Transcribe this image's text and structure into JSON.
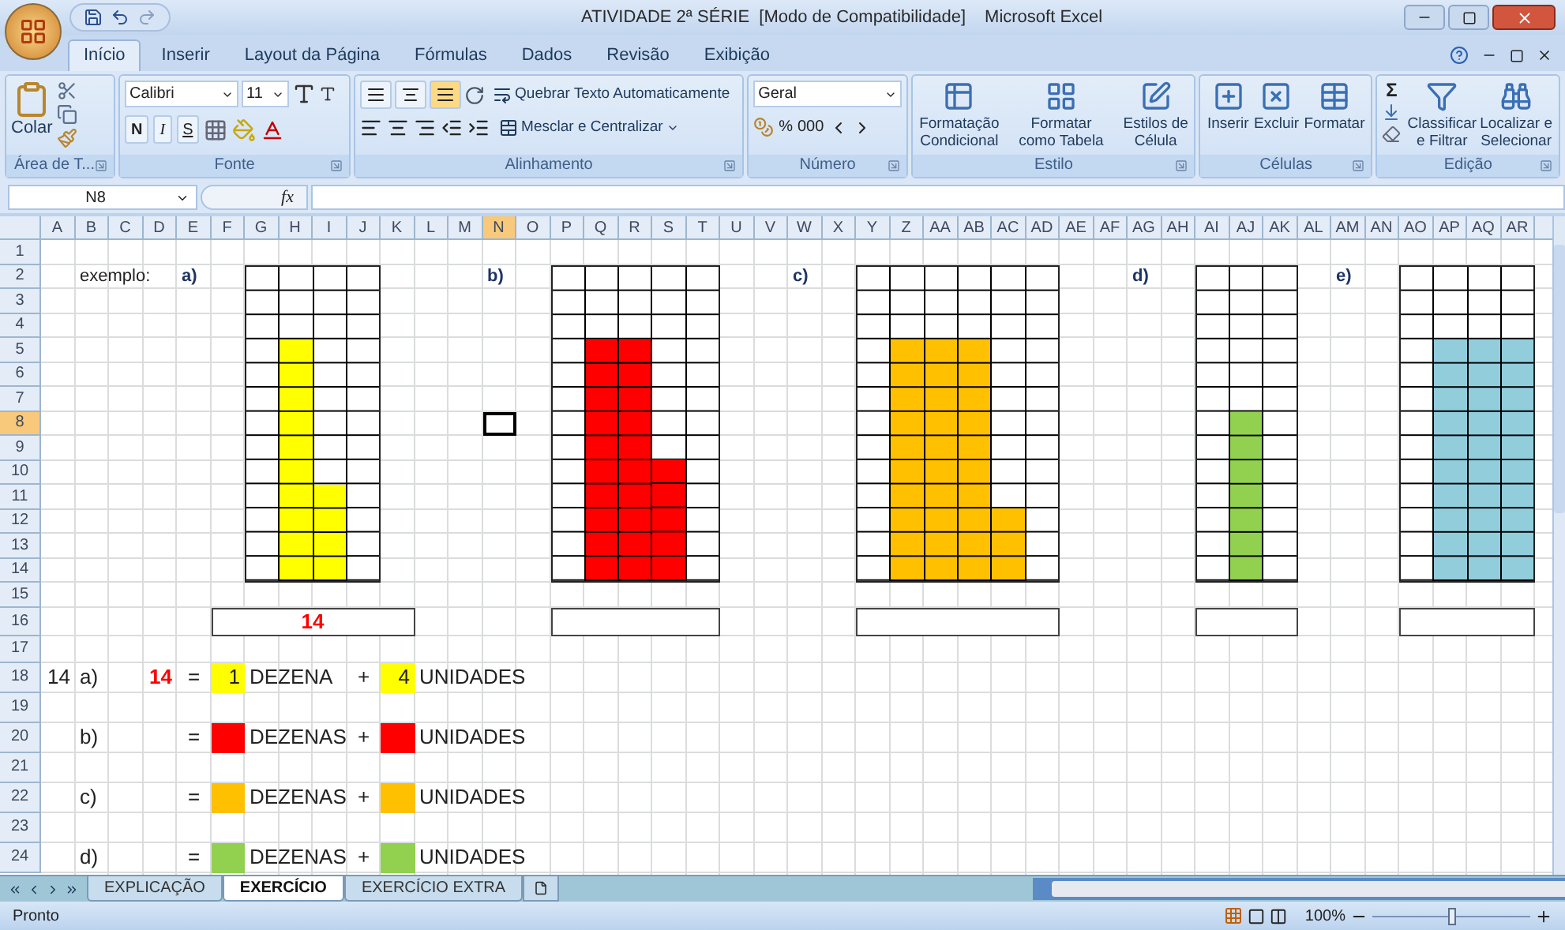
{
  "title_bar": {
    "document": "ATIVIDADE 2ª SÉRIE  [Modo de Compatibilidade]",
    "app": "Microsoft Excel"
  },
  "ribbon_tabs": [
    {
      "label": "Início",
      "selected": true
    },
    {
      "label": "Inserir",
      "selected": false
    },
    {
      "label": "Layout da Página",
      "selected": false
    },
    {
      "label": "Fórmulas",
      "selected": false
    },
    {
      "label": "Dados",
      "selected": false
    },
    {
      "label": "Revisão",
      "selected": false
    },
    {
      "label": "Exibição",
      "selected": false
    }
  ],
  "ribbon_groups": [
    {
      "kind": "clipboard",
      "label": "Área de T...",
      "paste": "Colar"
    },
    {
      "kind": "font",
      "label": "Fonte",
      "font": "Calibri",
      "size": "11",
      "bold": "N",
      "italic": "I",
      "underline": "S"
    },
    {
      "kind": "alignment",
      "label": "Alinhamento",
      "wrap": "Quebrar Texto Automaticamente",
      "merge": "Mesclar e Centralizar",
      "vertical_align": [
        {
          "selected": false
        },
        {
          "selected": false
        },
        {
          "selected": true
        }
      ]
    },
    {
      "kind": "number",
      "label": "Número",
      "format": "Geral",
      "percent": "%",
      "thousands": "000"
    },
    {
      "kind": "styles",
      "label": "Estilo",
      "buttons": [
        {
          "lines": [
            "Formatação",
            "Condicional"
          ]
        },
        {
          "lines": [
            "Formatar",
            "como Tabela"
          ]
        },
        {
          "lines": [
            "Estilos de",
            "Célula"
          ]
        }
      ]
    },
    {
      "kind": "cells",
      "label": "Células",
      "buttons": [
        {
          "lines": [
            "Inserir"
          ]
        },
        {
          "lines": [
            "Excluir"
          ]
        },
        {
          "lines": [
            "Formatar"
          ]
        }
      ]
    },
    {
      "kind": "editing",
      "label": "Edição",
      "sum": "Σ",
      "buttons": [
        {
          "lines": [
            "Classificar",
            "e Filtrar"
          ]
        },
        {
          "lines": [
            "Localizar e",
            "Selecionar"
          ]
        }
      ]
    }
  ],
  "formula_bar": {
    "name_box": "N8",
    "function_label": "fx"
  },
  "sheet": {
    "columns": [
      {
        "label": "A",
        "selected": false
      },
      {
        "label": "B",
        "selected": false
      },
      {
        "label": "C",
        "selected": false
      },
      {
        "label": "D",
        "selected": false
      },
      {
        "label": "E",
        "selected": false
      },
      {
        "label": "F",
        "selected": false
      },
      {
        "label": "G",
        "selected": false
      },
      {
        "label": "H",
        "selected": false
      },
      {
        "label": "I",
        "selected": false
      },
      {
        "label": "J",
        "selected": false
      },
      {
        "label": "K",
        "selected": false
      },
      {
        "label": "L",
        "selected": false
      },
      {
        "label": "M",
        "selected": false
      },
      {
        "label": "N",
        "selected": true
      },
      {
        "label": "O",
        "selected": false
      },
      {
        "label": "P",
        "selected": false
      },
      {
        "label": "Q",
        "selected": false
      },
      {
        "label": "R",
        "selected": false
      },
      {
        "label": "S",
        "selected": false
      },
      {
        "label": "T",
        "selected": false
      },
      {
        "label": "U",
        "selected": false
      },
      {
        "label": "V",
        "selected": false
      },
      {
        "label": "W",
        "selected": false
      },
      {
        "label": "X",
        "selected": false
      },
      {
        "label": "Y",
        "selected": false
      },
      {
        "label": "Z",
        "selected": false
      },
      {
        "label": "AA",
        "selected": false
      },
      {
        "label": "AB",
        "selected": false
      },
      {
        "label": "AC",
        "selected": false
      },
      {
        "label": "AD",
        "selected": false
      },
      {
        "label": "AE",
        "selected": false
      },
      {
        "label": "AF",
        "selected": false
      },
      {
        "label": "AG",
        "selected": false
      },
      {
        "label": "AH",
        "selected": false
      },
      {
        "label": "AI",
        "selected": false
      },
      {
        "label": "AJ",
        "selected": false
      },
      {
        "label": "AK",
        "selected": false
      },
      {
        "label": "AL",
        "selected": false
      },
      {
        "label": "AM",
        "selected": false
      },
      {
        "label": "AN",
        "selected": false
      },
      {
        "label": "AO",
        "selected": false
      },
      {
        "label": "AP",
        "selected": false
      },
      {
        "label": "AQ",
        "selected": false
      },
      {
        "label": "AR",
        "selected": false
      }
    ],
    "rows": [
      {
        "label": "1",
        "selected": false
      },
      {
        "label": "2",
        "selected": false
      },
      {
        "label": "3",
        "selected": false
      },
      {
        "label": "4",
        "selected": false
      },
      {
        "label": "5",
        "selected": false
      },
      {
        "label": "6",
        "selected": false
      },
      {
        "label": "7",
        "selected": false
      },
      {
        "label": "8",
        "selected": true
      },
      {
        "label": "9",
        "selected": false
      },
      {
        "label": "10",
        "selected": false
      },
      {
        "label": "11",
        "selected": false
      },
      {
        "label": "12",
        "selected": false
      },
      {
        "label": "13",
        "selected": false
      },
      {
        "label": "14",
        "selected": false
      },
      {
        "label": "15",
        "selected": false
      },
      {
        "label": "16",
        "selected": false
      },
      {
        "label": "17",
        "selected": false
      },
      {
        "label": "18",
        "selected": false
      },
      {
        "label": "19",
        "selected": false
      },
      {
        "label": "20",
        "selected": false
      },
      {
        "label": "21",
        "selected": false
      },
      {
        "label": "22",
        "selected": false
      },
      {
        "label": "23",
        "selected": false
      },
      {
        "label": "24",
        "selected": false
      }
    ],
    "example_label": "exemplo:",
    "exercises": [
      {
        "label": "a)",
        "color": "#ffff00",
        "answer": "14",
        "columns": [
          {
            "filled": false
          },
          {
            "filled": true,
            "level": 0.769
          },
          {
            "filled": true,
            "level": 0.308
          },
          {
            "filled": false
          }
        ]
      },
      {
        "label": "b)",
        "color": "#ff0000",
        "columns": [
          {
            "filled": false
          },
          {
            "filled": true,
            "level": 0.769
          },
          {
            "filled": true,
            "level": 0.769
          },
          {
            "filled": true,
            "level": 0.385
          },
          {
            "filled": false
          }
        ]
      },
      {
        "label": "c)",
        "color": "#ffc000",
        "columns": [
          {
            "filled": false
          },
          {
            "filled": true,
            "level": 0.769
          },
          {
            "filled": true,
            "level": 0.769
          },
          {
            "filled": true,
            "level": 0.769
          },
          {
            "filled": true,
            "level": 0.231
          },
          {
            "filled": false
          }
        ]
      },
      {
        "label": "d)",
        "color": "#92d050",
        "columns": [
          {
            "filled": false
          },
          {
            "filled": true,
            "level": 0.538
          },
          {
            "filled": false
          }
        ]
      },
      {
        "label": "e)",
        "color": "#92cddc",
        "columns": [
          {
            "filled": false
          },
          {
            "filled": true,
            "level": 0.769
          },
          {
            "filled": true,
            "level": 0.769
          },
          {
            "filled": true,
            "level": 0.769
          }
        ]
      }
    ],
    "answer_rows": [
      {
        "index": "14",
        "label": "a)",
        "number": "14",
        "equals": "=",
        "tens": "1",
        "tens_word": "DEZENA",
        "plus": "+",
        "units": "4",
        "units_word": "UNIDADES",
        "color": "#ffff00"
      },
      {
        "label": "b)",
        "equals": "=",
        "tens_word": "DEZENAS",
        "plus": "+",
        "units_word": "UNIDADES",
        "color": "#ff0000"
      },
      {
        "label": "c)",
        "equals": "=",
        "tens_word": "DEZENAS",
        "plus": "+",
        "units_word": "UNIDADES",
        "color": "#ffc000"
      },
      {
        "label": "d)",
        "equals": "=",
        "tens_word": "DEZENAS",
        "plus": "+",
        "units_word": "UNIDADES",
        "color": "#92d050"
      }
    ]
  },
  "sheet_tabs": [
    {
      "label": "EXPLICAÇÃO",
      "selected": false
    },
    {
      "label": "EXERCÍCIO",
      "selected": true
    },
    {
      "label": "EXERCÍCIO EXTRA",
      "selected": false
    }
  ],
  "status_bar": {
    "status": "Pronto",
    "zoom": "100%",
    "zoom_slider": {
      "level": 0.5
    }
  }
}
